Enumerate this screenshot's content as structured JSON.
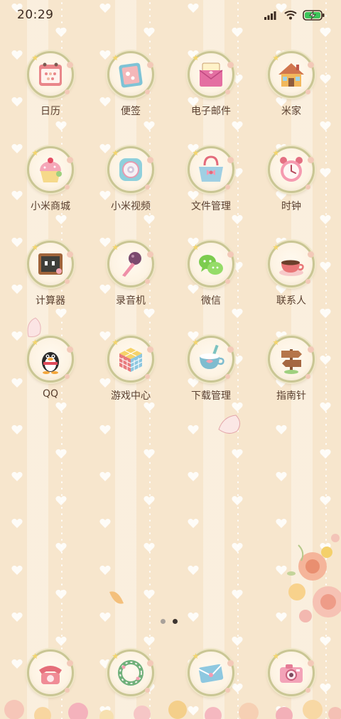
{
  "status_bar": {
    "time": "20:29",
    "icons": [
      "signal-icon",
      "wifi-icon",
      "battery-charging-icon"
    ]
  },
  "apps": [
    {
      "label": "日历",
      "icon": "calendar-icon"
    },
    {
      "label": "便签",
      "icon": "notes-icon"
    },
    {
      "label": "电子邮件",
      "icon": "email-icon"
    },
    {
      "label": "米家",
      "icon": "house-icon"
    },
    {
      "label": "小米商城",
      "icon": "cupcake-icon"
    },
    {
      "label": "小米视频",
      "icon": "video-icon"
    },
    {
      "label": "文件管理",
      "icon": "handbag-icon"
    },
    {
      "label": "时钟",
      "icon": "alarm-clock-icon"
    },
    {
      "label": "计算器",
      "icon": "chalkboard-icon"
    },
    {
      "label": "录音机",
      "icon": "microphone-icon"
    },
    {
      "label": "微信",
      "icon": "wechat-icon"
    },
    {
      "label": "联系人",
      "icon": "coffee-cup-icon"
    },
    {
      "label": "QQ",
      "icon": "penguin-icon"
    },
    {
      "label": "游戏中心",
      "icon": "cube-icon"
    },
    {
      "label": "下载管理",
      "icon": "tea-cup-icon"
    },
    {
      "label": "指南针",
      "icon": "signpost-icon"
    }
  ],
  "page_indicator": {
    "count": 2,
    "active_index": 1
  },
  "dock": [
    {
      "icon": "phone-icon"
    },
    {
      "icon": "wreath-icon"
    },
    {
      "icon": "envelope-icon"
    },
    {
      "icon": "camera-icon"
    }
  ],
  "colors": {
    "background": "#f7e6cd",
    "icon_ring": "#c9c694",
    "label": "#5a4030"
  }
}
